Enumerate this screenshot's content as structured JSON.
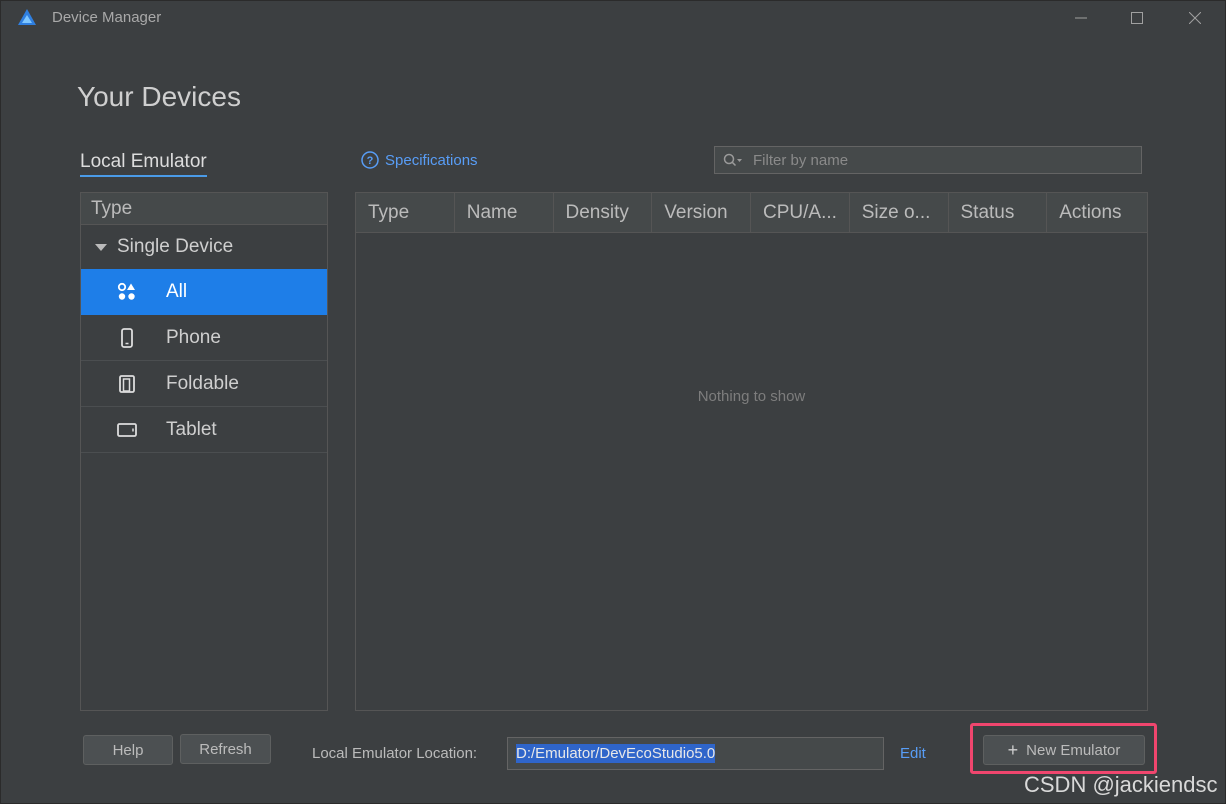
{
  "window": {
    "title": "Device Manager"
  },
  "page": {
    "title": "Your Devices"
  },
  "tabs": {
    "local_emulator": "Local Emulator"
  },
  "specs_link": "Specifications",
  "filter": {
    "placeholder": "Filter by name"
  },
  "type_panel": {
    "header": "Type",
    "group": "Single Device",
    "items": [
      {
        "label": "All",
        "icon": "all-devices-icon",
        "selected": true
      },
      {
        "label": "Phone",
        "icon": "phone-icon",
        "selected": false
      },
      {
        "label": "Foldable",
        "icon": "foldable-icon",
        "selected": false
      },
      {
        "label": "Tablet",
        "icon": "tablet-icon",
        "selected": false
      }
    ]
  },
  "table": {
    "columns": [
      "Type",
      "Name",
      "Density",
      "Version",
      "CPU/A...",
      "Size o...",
      "Status",
      "Actions"
    ],
    "empty_message": "Nothing to show"
  },
  "footer": {
    "help_label": "Help",
    "refresh_label": "Refresh",
    "location_label": "Local Emulator Location:",
    "location_value": "D:/Emulator/DevEcoStudio5.0",
    "edit_label": "Edit",
    "new_emulator_label": "New Emulator"
  },
  "watermark": "CSDN @jackiendsc",
  "colors": {
    "accent": "#1e7ee8",
    "link": "#589df6",
    "highlight": "#f0466e",
    "background": "#3c3f41"
  }
}
